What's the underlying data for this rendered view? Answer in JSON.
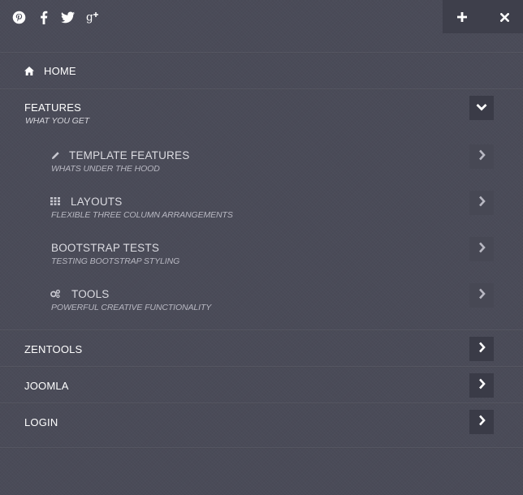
{
  "social": [
    {
      "name": "pinterest-icon",
      "label": "Pinterest"
    },
    {
      "name": "facebook-icon",
      "label": "Facebook"
    },
    {
      "name": "twitter-icon",
      "label": "Twitter"
    },
    {
      "name": "google-plus-icon",
      "label": "Google+"
    }
  ],
  "controls": {
    "expand_icon": "plus-icon",
    "close_icon": "close-icon"
  },
  "menu": {
    "home": {
      "label": "HOME",
      "icon": "home-icon"
    },
    "features": {
      "label": "FEATURES",
      "description": "WHAT YOU GET",
      "toggle_icon": "chevron-down-icon",
      "children": [
        {
          "label": "TEMPLATE FEATURES",
          "description": "WHATS UNDER THE HOOD",
          "icon": "pencil-icon",
          "toggle_icon": "chevron-right-icon"
        },
        {
          "label": "LAYOUTS",
          "description": "FLEXIBLE THREE COLUMN ARRANGEMENTS",
          "icon": "grid-icon",
          "toggle_icon": "chevron-right-icon"
        },
        {
          "label": "BOOTSTRAP TESTS",
          "description": "TESTING BOOTSTRAP STYLING",
          "icon": "",
          "toggle_icon": "chevron-right-icon"
        },
        {
          "label": "TOOLS",
          "description": "POWERFUL CREATIVE FUNCTIONALITY",
          "icon": "cogs-icon",
          "toggle_icon": "chevron-right-icon"
        }
      ]
    },
    "zentools": {
      "label": "ZENTOOLS",
      "toggle_icon": "chevron-right-icon"
    },
    "joomla": {
      "label": "JOOMLA",
      "toggle_icon": "chevron-right-icon"
    },
    "login": {
      "label": "LOGIN",
      "toggle_icon": "chevron-right-icon"
    }
  },
  "colors": {
    "background": "#4a4b58",
    "toggle_bg": "#3a3b47",
    "control_bg": "#3e3f4b",
    "text": "#ffffff"
  }
}
